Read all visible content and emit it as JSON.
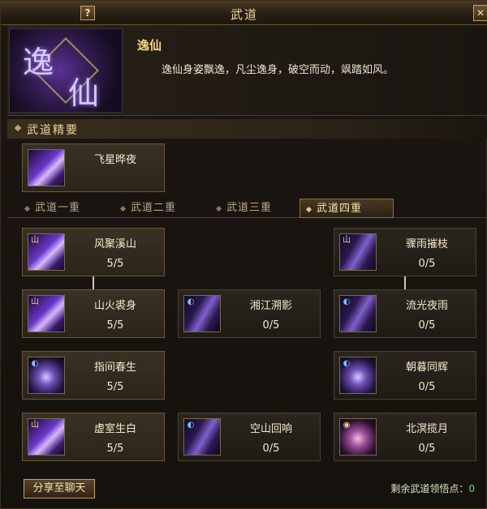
{
  "window": {
    "title": "武道",
    "help": "?",
    "close": "✕"
  },
  "header": {
    "emblem_glyphs": [
      "逸",
      "仙"
    ],
    "name": "逸仙",
    "description": "逸仙身姿飘逸，凡尘逸身，破空而动，飒踏如风。"
  },
  "essentials": {
    "title": "武道精要",
    "skill": {
      "name": "飞星晔夜",
      "icon": "purple-figure-icon"
    }
  },
  "tabs": [
    "武道一重",
    "武道二重",
    "武道三重",
    "武道四重"
  ],
  "active_tab": 3,
  "skills": [
    {
      "name": "风聚溪山",
      "level": "5/5",
      "icon": "purple-blade-icon"
    },
    {
      "name": "骤雨摧枝",
      "level": "0/5",
      "icon": "streak-icon"
    },
    {
      "name": "山火裘身",
      "level": "5/5",
      "icon": "purple-blade-icon"
    },
    {
      "name": "湘江溯影",
      "level": "0/5",
      "icon": "streak-moon-icon"
    },
    {
      "name": "流光夜雨",
      "level": "0/5",
      "icon": "streak-moon-icon"
    },
    {
      "name": "指间春生",
      "level": "5/5",
      "icon": "moon-icon"
    },
    {
      "name": "朝暮同辉",
      "level": "0/5",
      "icon": "moon-icon"
    },
    {
      "name": "虚室生白",
      "level": "5/5",
      "icon": "purple-blade-icon"
    },
    {
      "name": "空山回响",
      "level": "0/5",
      "icon": "streak-moon-icon"
    },
    {
      "name": "北溟揽月",
      "level": "0/5",
      "icon": "pink-moon-icon"
    }
  ],
  "footer": {
    "share_label": "分享至聊天",
    "points_label": "剩余武道领悟点：",
    "points_value": "0"
  },
  "colors": {
    "accent": "#f0d69a",
    "points": "#60e060",
    "border": "#6a5838"
  }
}
